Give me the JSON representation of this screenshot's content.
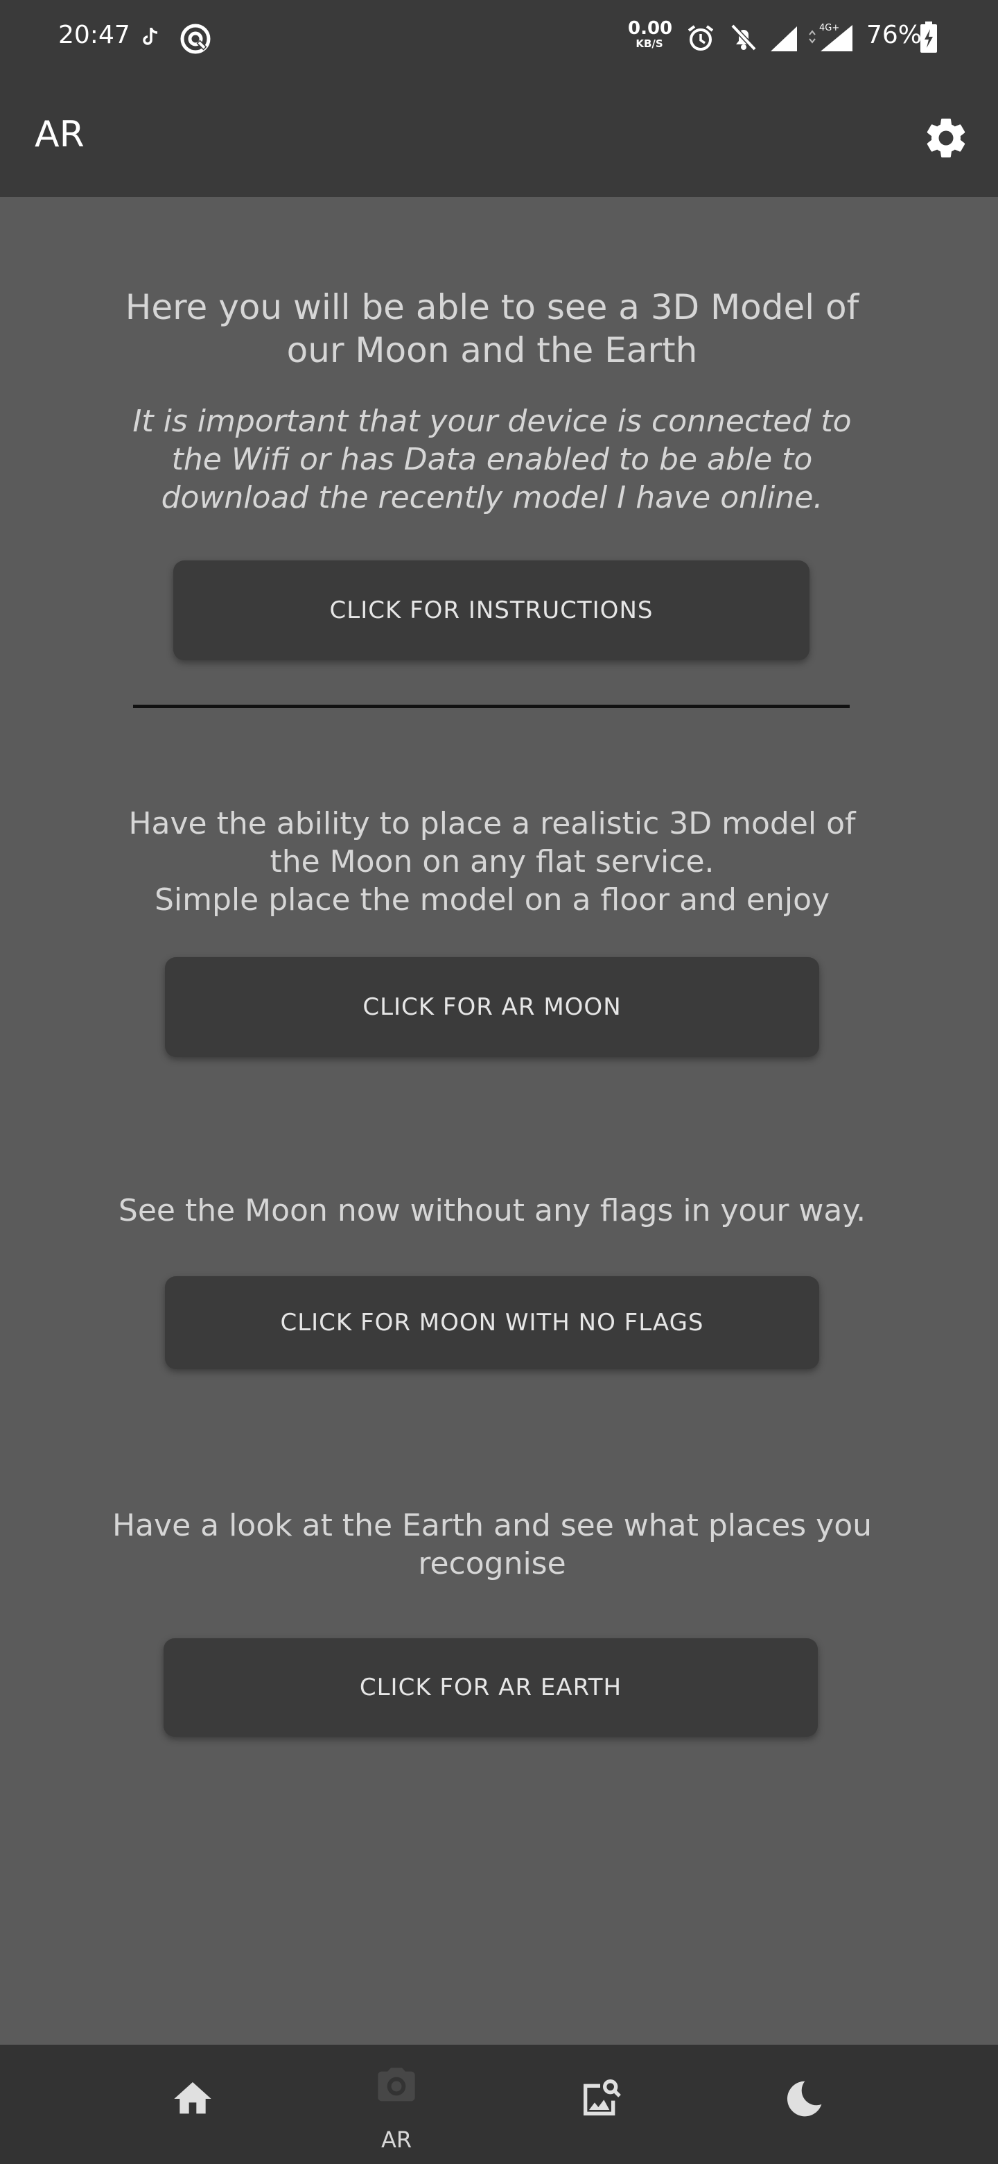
{
  "status_bar": {
    "time": "20:47",
    "net_speed_value": "0.00",
    "net_speed_unit": "KB/S",
    "network_type": "4G+",
    "battery": "76%",
    "icons": [
      "tiktok-icon",
      "vpn-icon",
      "alarm-icon",
      "bell-off-icon",
      "signal-icon",
      "signal-4g-icon",
      "battery-charging-icon"
    ]
  },
  "app_bar": {
    "title": "AR",
    "settings_icon": "gear-icon"
  },
  "main": {
    "intro_heading": "Here you will be able to see a 3D Model of our Moon and the Earth",
    "intro_note": "It is important that your device is connected to the Wifi or has Data enabled to be able to download the recently model I have online.",
    "instructions_button": "CLICK FOR INSTRUCTIONS",
    "moon_description_line1": "Have the ability to place a realistic 3D model of the Moon on any flat service.",
    "moon_description_line2": "Simple place the model on a floor and enjoy",
    "moon_button": "CLICK FOR AR MOON",
    "flags_description": "See the Moon now without any flags in your way.",
    "flags_button": "CLICK FOR MOON WITH NO FLAGS",
    "earth_description": "Have a look at the Earth and see what places you recognise",
    "earth_button": "CLICK FOR AR EARTH"
  },
  "bottom_nav": {
    "items": [
      {
        "icon": "home-icon",
        "label": ""
      },
      {
        "icon": "camera-icon",
        "label": "AR",
        "selected": true
      },
      {
        "icon": "image-search-icon",
        "label": ""
      },
      {
        "icon": "moon-icon",
        "label": ""
      }
    ]
  },
  "colors": {
    "background": "#5b5b5b",
    "bar": "#3a3a3a",
    "button": "#3b3b3b",
    "text": "#d6d6d6"
  }
}
